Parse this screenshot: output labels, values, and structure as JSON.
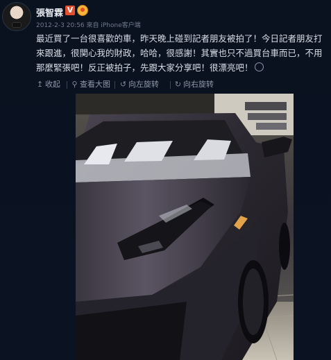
{
  "author": {
    "name": "張智霖",
    "verified_badge": "V"
  },
  "meta": "2012-2-3 20:56 來自 iPhone客户端",
  "content": "最近買了一台很喜歡的車，昨天晚上碰到記者朋友被拍了！今日記者朋友打來跟進，很関心我的財政，哈哈，很感謝！其實也只不過買台車而已，不用那麼緊張吧！反正被拍子，先跟大家分享吧！很漂亮吧！",
  "toolbar": {
    "collapse": "收起",
    "view_large": "查看大图",
    "rotate_left": "向左旋转",
    "rotate_right": "向右旋转"
  },
  "colors": {
    "background": "#0b1220",
    "text": "#d9dee6",
    "muted": "#6f7b8c",
    "badge": "#e54e2e"
  },
  "icons": [
    "collapse-arrow-icon",
    "magnifier-icon",
    "rotate-left-icon",
    "rotate-right-icon",
    "smile-emoji-icon",
    "medal-icon"
  ]
}
